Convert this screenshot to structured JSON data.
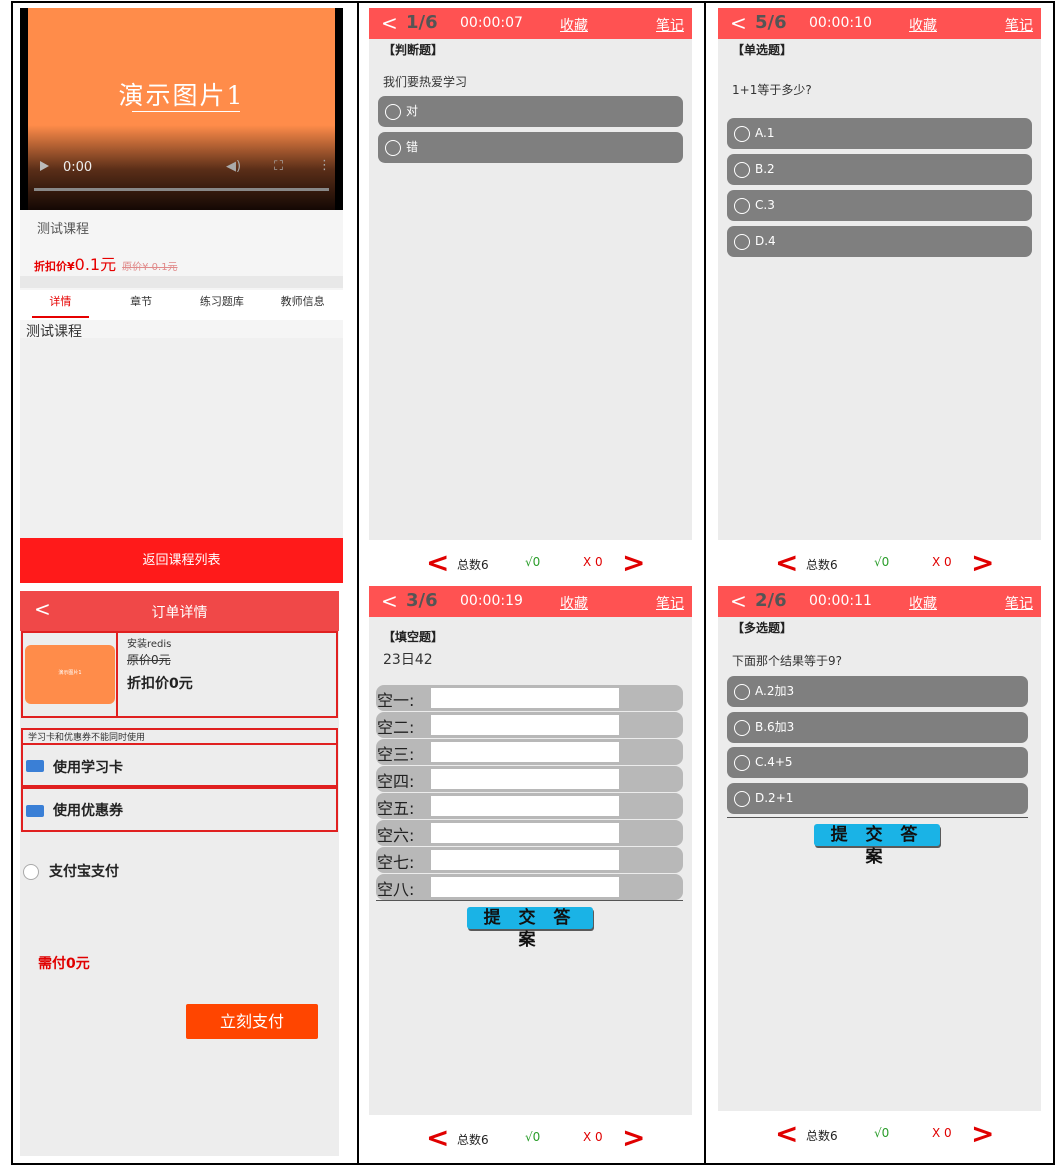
{
  "course": {
    "poster_text": "演示图片1",
    "video_time": "0:00",
    "title": "测试课程",
    "discount_label": "折扣价¥",
    "discount_value": "0.1元",
    "original_price": "原价¥ 0.1元",
    "tabs": [
      "详情",
      "章节",
      "练习题库",
      "教师信息"
    ],
    "detail_text": "测试课程",
    "back_button": "返回课程列表"
  },
  "order": {
    "title": "订单详情",
    "thumb_text": "演示图片1",
    "product_name": "安装redis",
    "original_price": "原价0元",
    "discount_price": "折扣价0元",
    "card_warning": "学习卡和优惠券不能同时使用",
    "use_card": "使用学习卡",
    "use_coupon": "使用优惠券",
    "alipay": "支付宝支付",
    "need_pay": "需付0元",
    "pay_button": "立刻支付"
  },
  "quiz_common": {
    "fav": "收藏",
    "note": "笔记",
    "total": "总数6",
    "right": "√0",
    "wrong": "X 0",
    "submit": "提 交 答 案"
  },
  "quiz_judge": {
    "position": "1/6",
    "timer": "00:00:07",
    "type": "【判断题】",
    "question": "我们要热爱学习",
    "options": [
      "对",
      "错"
    ]
  },
  "quiz_single": {
    "position": "5/6",
    "timer": "00:00:10",
    "type": "【单选题】",
    "question": "1+1等于多少?",
    "options": [
      "A.1",
      "B.2",
      "C.3",
      "D.4"
    ]
  },
  "quiz_blank": {
    "position": "3/6",
    "timer": "00:00:19",
    "type": "【填空题】",
    "question": "23日42",
    "blanks": [
      "空一:",
      "空二:",
      "空三:",
      "空四:",
      "空五:",
      "空六:",
      "空七:",
      "空八:"
    ]
  },
  "quiz_multi": {
    "position": "2/6",
    "timer": "00:00:11",
    "type": "【多选题】",
    "question": "下面那个结果等于9?",
    "options": [
      "A.2加3",
      "B.6加3",
      "C.4+5",
      "D.2+1"
    ]
  },
  "colors": {
    "header_red": "#ff5252",
    "option_gray": "#7f7f7f",
    "submit_blue": "#1ab3e6",
    "pay_orange": "#ff4500"
  }
}
